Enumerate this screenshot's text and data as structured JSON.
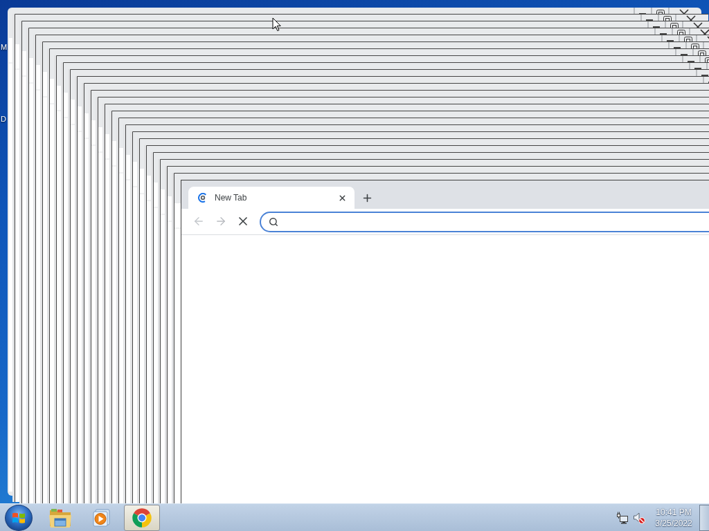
{
  "desktop": {
    "icons": [
      {
        "label": "M"
      },
      {
        "label": "D"
      }
    ]
  },
  "browser": {
    "tabs": [
      {
        "title": "New Tab",
        "selected": true,
        "loading": true
      }
    ],
    "toolbar": {
      "back_disabled": true,
      "forward_disabled": true,
      "loading": true
    },
    "omnibox": {
      "focused": true
    }
  },
  "taskbar": {
    "apps": [
      {
        "kind": "explorer",
        "active": false
      },
      {
        "kind": "media-player",
        "active": false
      },
      {
        "kind": "browser",
        "active": true
      }
    ],
    "tray": {
      "volume_muted": true,
      "time": "10:41 PM",
      "date": "3/25/2022"
    }
  }
}
